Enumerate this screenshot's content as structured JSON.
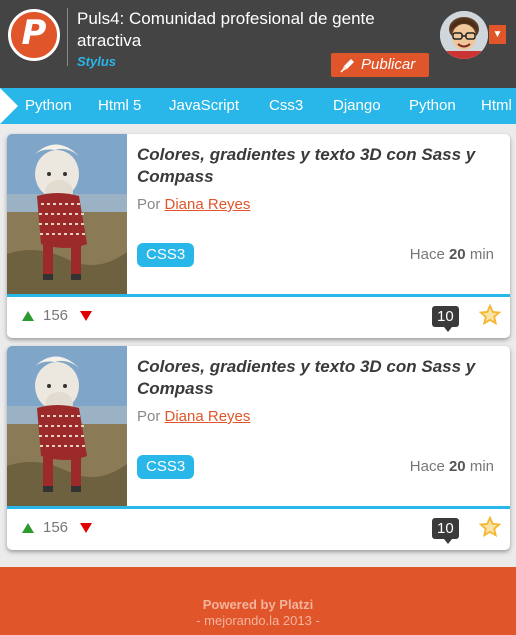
{
  "header": {
    "logo_letter": "P",
    "title": "Puls4: Comunidad profesional de gente atractiva",
    "subtitle": "Stylus",
    "publish_label": "Publicar",
    "menu_caret": "▼"
  },
  "tabs": [
    "Python",
    "Html 5",
    "JavaScript",
    "Css3",
    "Django",
    "Python",
    "Html"
  ],
  "posts": [
    {
      "title": "Colores, gradientes y texto 3D con Sass y Compass",
      "by_label": "Por",
      "author": "Diana Reyes",
      "tag": "CSS3",
      "time_prefix": "Hace",
      "time_value": "20",
      "time_unit": "min",
      "votes": "156",
      "comments": "10"
    },
    {
      "title": "Colores, gradientes y texto 3D con Sass y Compass",
      "by_label": "Por",
      "author": "Diana Reyes",
      "tag": "CSS3",
      "time_prefix": "Hace",
      "time_value": "20",
      "time_unit": "min",
      "votes": "156",
      "comments": "10"
    }
  ],
  "footer": {
    "powered": "Powered by Platzi",
    "copyright": "- mejorando.la 2013 -"
  },
  "colors": {
    "header_bg": "#444444",
    "accent_orange": "#e1552a",
    "accent_blue": "#29b6e8",
    "vote_up": "#2d9a2d",
    "vote_down": "#e00000",
    "star": "#f5b731"
  },
  "icons": [
    "logo",
    "pen-icon",
    "chevron-down-icon",
    "vote-up-icon",
    "vote-down-icon",
    "comment-icon",
    "star-icon"
  ]
}
